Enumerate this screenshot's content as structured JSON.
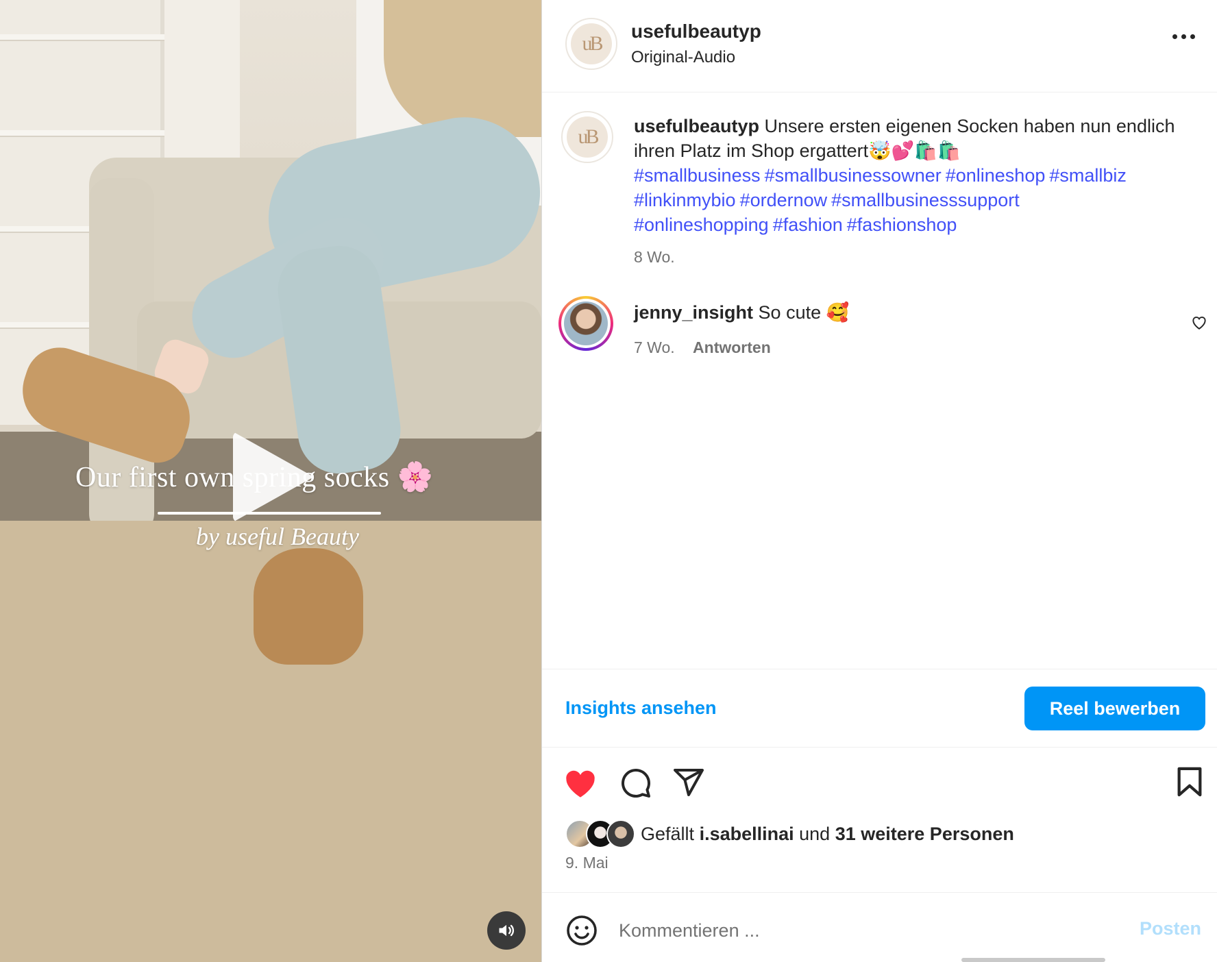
{
  "video": {
    "overlay_title": "Our first own spring socks 🌸",
    "overlay_subtitle": "by useful Beauty",
    "play_icon": "play-icon",
    "sound_icon": "speaker-icon"
  },
  "header": {
    "username": "usefulbeautyp",
    "audio": "Original-Audio",
    "avatar_text": "uB",
    "more_icon": "more-options-icon"
  },
  "caption": {
    "username": "usefulbeautyp",
    "text": "Unsere ersten eigenen Socken haben nun endlich ihren Platz im Shop ergattert🤯💕🛍️🛍️",
    "hashtags": [
      "#smallbusiness",
      "#smallbusinessowner",
      "#onlineshop",
      "#smallbiz",
      "#linkinmybio",
      "#ordernow",
      "#smallbusinesssupport",
      "#onlineshopping",
      "#fashion",
      "#fashionshop"
    ],
    "time": "8 Wo."
  },
  "comments": [
    {
      "username": "jenny_insight",
      "text": "So cute 🥰",
      "time": "7 Wo.",
      "reply_label": "Antworten"
    }
  ],
  "actions": {
    "insights_label": "Insights ansehen",
    "boost_label": "Reel bewerben",
    "liked": true,
    "like_color": "#ff3040",
    "accent_color": "#0095f6"
  },
  "likes": {
    "prefix": "Gefällt",
    "user": "i.sabellinai",
    "middle": "und",
    "others": "31 weitere Personen"
  },
  "date": "9. Mai",
  "comment_box": {
    "placeholder": "Kommentieren ...",
    "post_label": "Posten"
  }
}
